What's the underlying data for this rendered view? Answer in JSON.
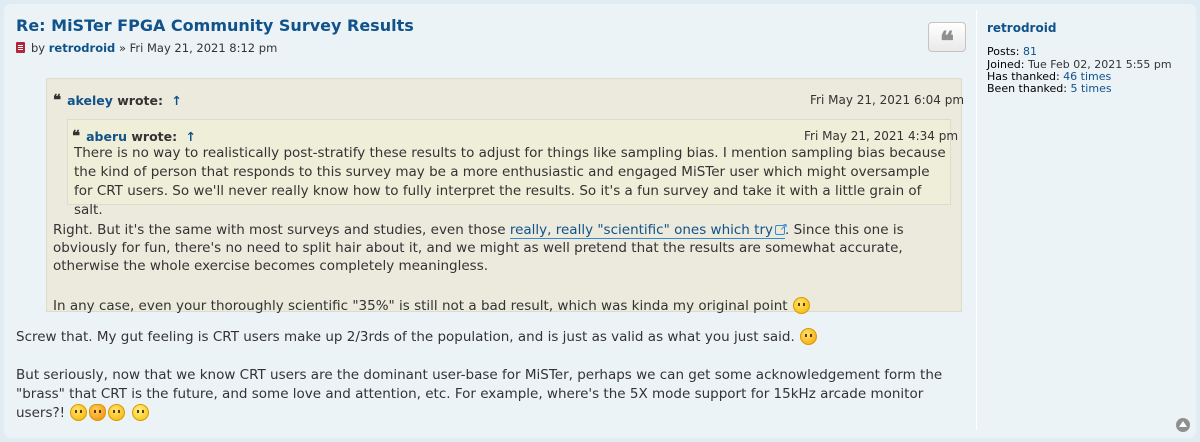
{
  "post": {
    "title": "Re: MiSTer FPGA Community Survey Results",
    "meta_by": "by",
    "author": "retrodroid",
    "date": "» Fri May 21, 2021 8:12 pm",
    "quote_button": "❝"
  },
  "outer_quote": {
    "qmark": "❝",
    "user": "akeley",
    "wrote": "wrote:",
    "arrow": "↑",
    "date": "Fri May 21, 2021 6:04 pm",
    "para1_before": "Right. But it's the same with most surveys and studies, even those ",
    "para1_link": "really, really \"scientific\" ones which try",
    "para1_after": ". Since this one is obviously for fun, there's no need to split hair about it, and we might as well pretend that the results are somewhat accurate, otherwise the whole exercise becomes completely meaningless.",
    "para2": "In any case, even your thoroughly scientific \"35%\" is still not a bad result, which was kinda my original point"
  },
  "inner_quote": {
    "qmark": "❝",
    "user": "aberu",
    "wrote": "wrote:",
    "arrow": "↑",
    "date": "Fri May 21, 2021 4:34 pm",
    "text": "There is no way to realistically post-stratify these results to adjust for things like sampling bias. I mention sampling bias because the kind of person that responds to this survey may be a more enthusiastic and engaged MiSTer user which might oversample for CRT users. So we'll never really know how to fully interpret the results. So it's a fun survey and take it with a little grain of salt."
  },
  "reply": {
    "para1": "Screw that. My gut feeling is CRT users make up 2/3rds of the population, and is just as valid as what you just said.",
    "para2": "But seriously, now that we know CRT users are the dominant user-base for MiSTer, perhaps we can get some acknowledgement form the \"brass\" that CRT is the future, and some love and attention, etc. For example, where's the 5X mode support for 15kHz arcade monitor users?!"
  },
  "profile": {
    "name": "retrodroid",
    "posts_label": "Posts:",
    "posts_value": "81",
    "joined_label": "Joined:",
    "joined_value": "Tue Feb 02, 2021 5:55 pm",
    "has_thanked_label": "Has thanked:",
    "has_thanked_value": "46 times",
    "been_thanked_label": "Been thanked:",
    "been_thanked_value": "5 times"
  },
  "colors": {
    "page_bg": "#e1ebf2",
    "post_bg": "#ecf3f7",
    "link": "#105289",
    "quote_bg": "#ebeadd"
  },
  "icons": [
    "post-icon",
    "quote-icon",
    "external-link-icon",
    "wink-emoji-icon",
    "tongue-emoji-icon",
    "cat-emoji-icon",
    "grin-emoji-icon",
    "back-to-top-icon"
  ]
}
